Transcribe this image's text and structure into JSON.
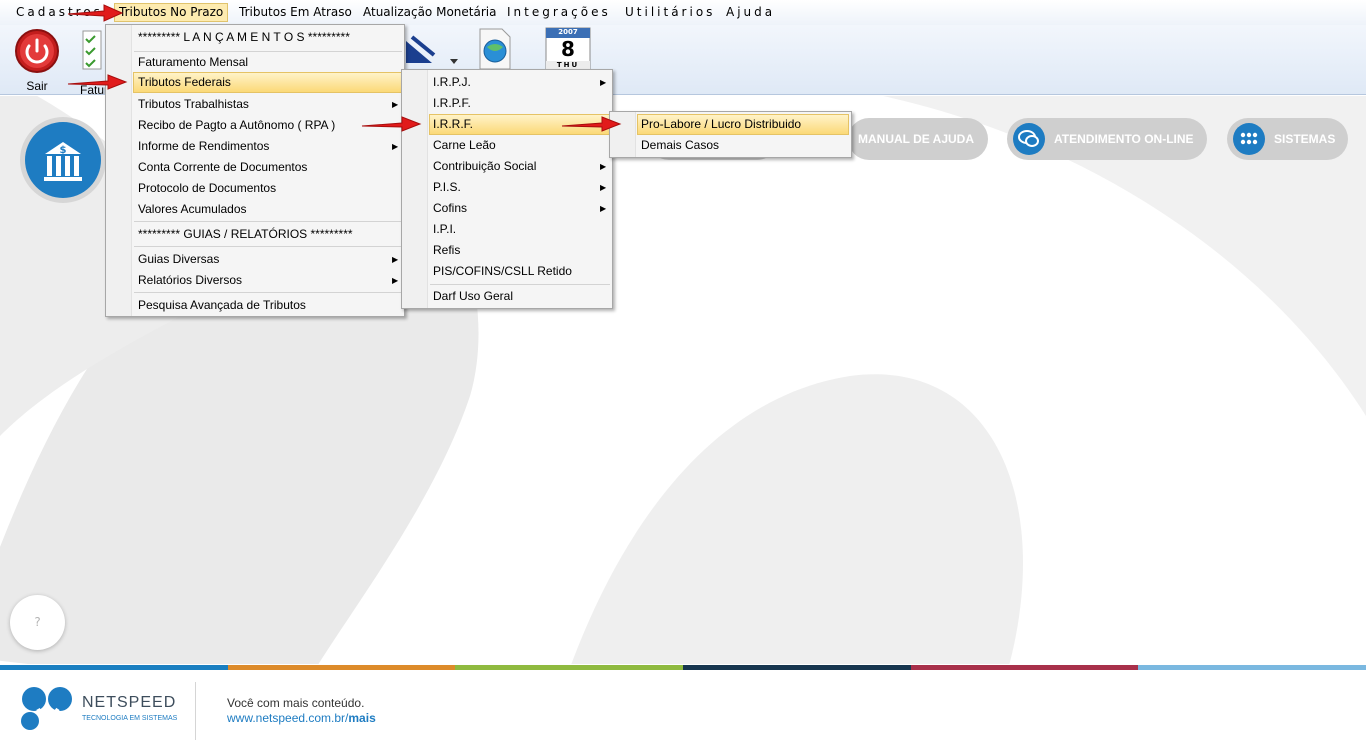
{
  "menubar": {
    "items": [
      {
        "label": "Cadastros"
      },
      {
        "label": "Tributos No Prazo"
      },
      {
        "label": "Tributos Em Atraso"
      },
      {
        "label": "Atualização Monetária"
      },
      {
        "label": "Integrações"
      },
      {
        "label": "Utilitários"
      },
      {
        "label": "Ajuda"
      }
    ]
  },
  "toolbar": {
    "sair_label": "Sair",
    "fatur_label": "Fatur",
    "calendar_day": "8",
    "calendar_month": "THU",
    "calendar_year": "2007"
  },
  "buttons": {
    "manual": "MANUAL DE AJUDA",
    "atendimento": "ATENDIMENTO ON-LINE",
    "sistemas": "SISTEMAS"
  },
  "help_bubble": "?",
  "menu_tributos": {
    "items": [
      "********* L A N Ç A M E N T O S *********",
      "Faturamento Mensal",
      "Tributos Federais",
      "Tributos Trabalhistas",
      "Recibo de Pagto a Autônomo ( RPA )",
      "Informe de Rendimentos",
      "Conta Corrente de Documentos",
      "Protocolo de Documentos",
      "Valores Acumulados",
      "********* GUIAS / RELATÓRIOS *********",
      "Guias Diversas",
      "Relatórios Diversos",
      "Pesquisa Avançada de Tributos"
    ]
  },
  "menu_federais": {
    "items": [
      "I.R.P.J.",
      "I.R.P.F.",
      "I.R.R.F.",
      "Carne Leão",
      "Contribuição Social",
      "P.I.S.",
      "Cofins",
      "I.P.I.",
      "Refis",
      "PIS/COFINS/CSLL Retido",
      "Darf Uso Geral"
    ]
  },
  "menu_irrf": {
    "items": [
      "Pro-Labore / Lucro Distribuido",
      "Demais Casos"
    ]
  },
  "footer": {
    "brand": "NETSPEED",
    "tagline": "TECNOLOGIA EM SISTEMAS",
    "slogan": "Você com mais conteúdo.",
    "url_prefix": "www.netspeed.com.br/",
    "url_suffix": "mais"
  },
  "colors": {
    "accent": "#1e7cc2",
    "highlight": "#fbd978",
    "stripe": [
      "#1a7fc1",
      "#dd8b2a",
      "#8fba3f",
      "#17364f",
      "#a8304a",
      "#7ab8e0"
    ]
  }
}
